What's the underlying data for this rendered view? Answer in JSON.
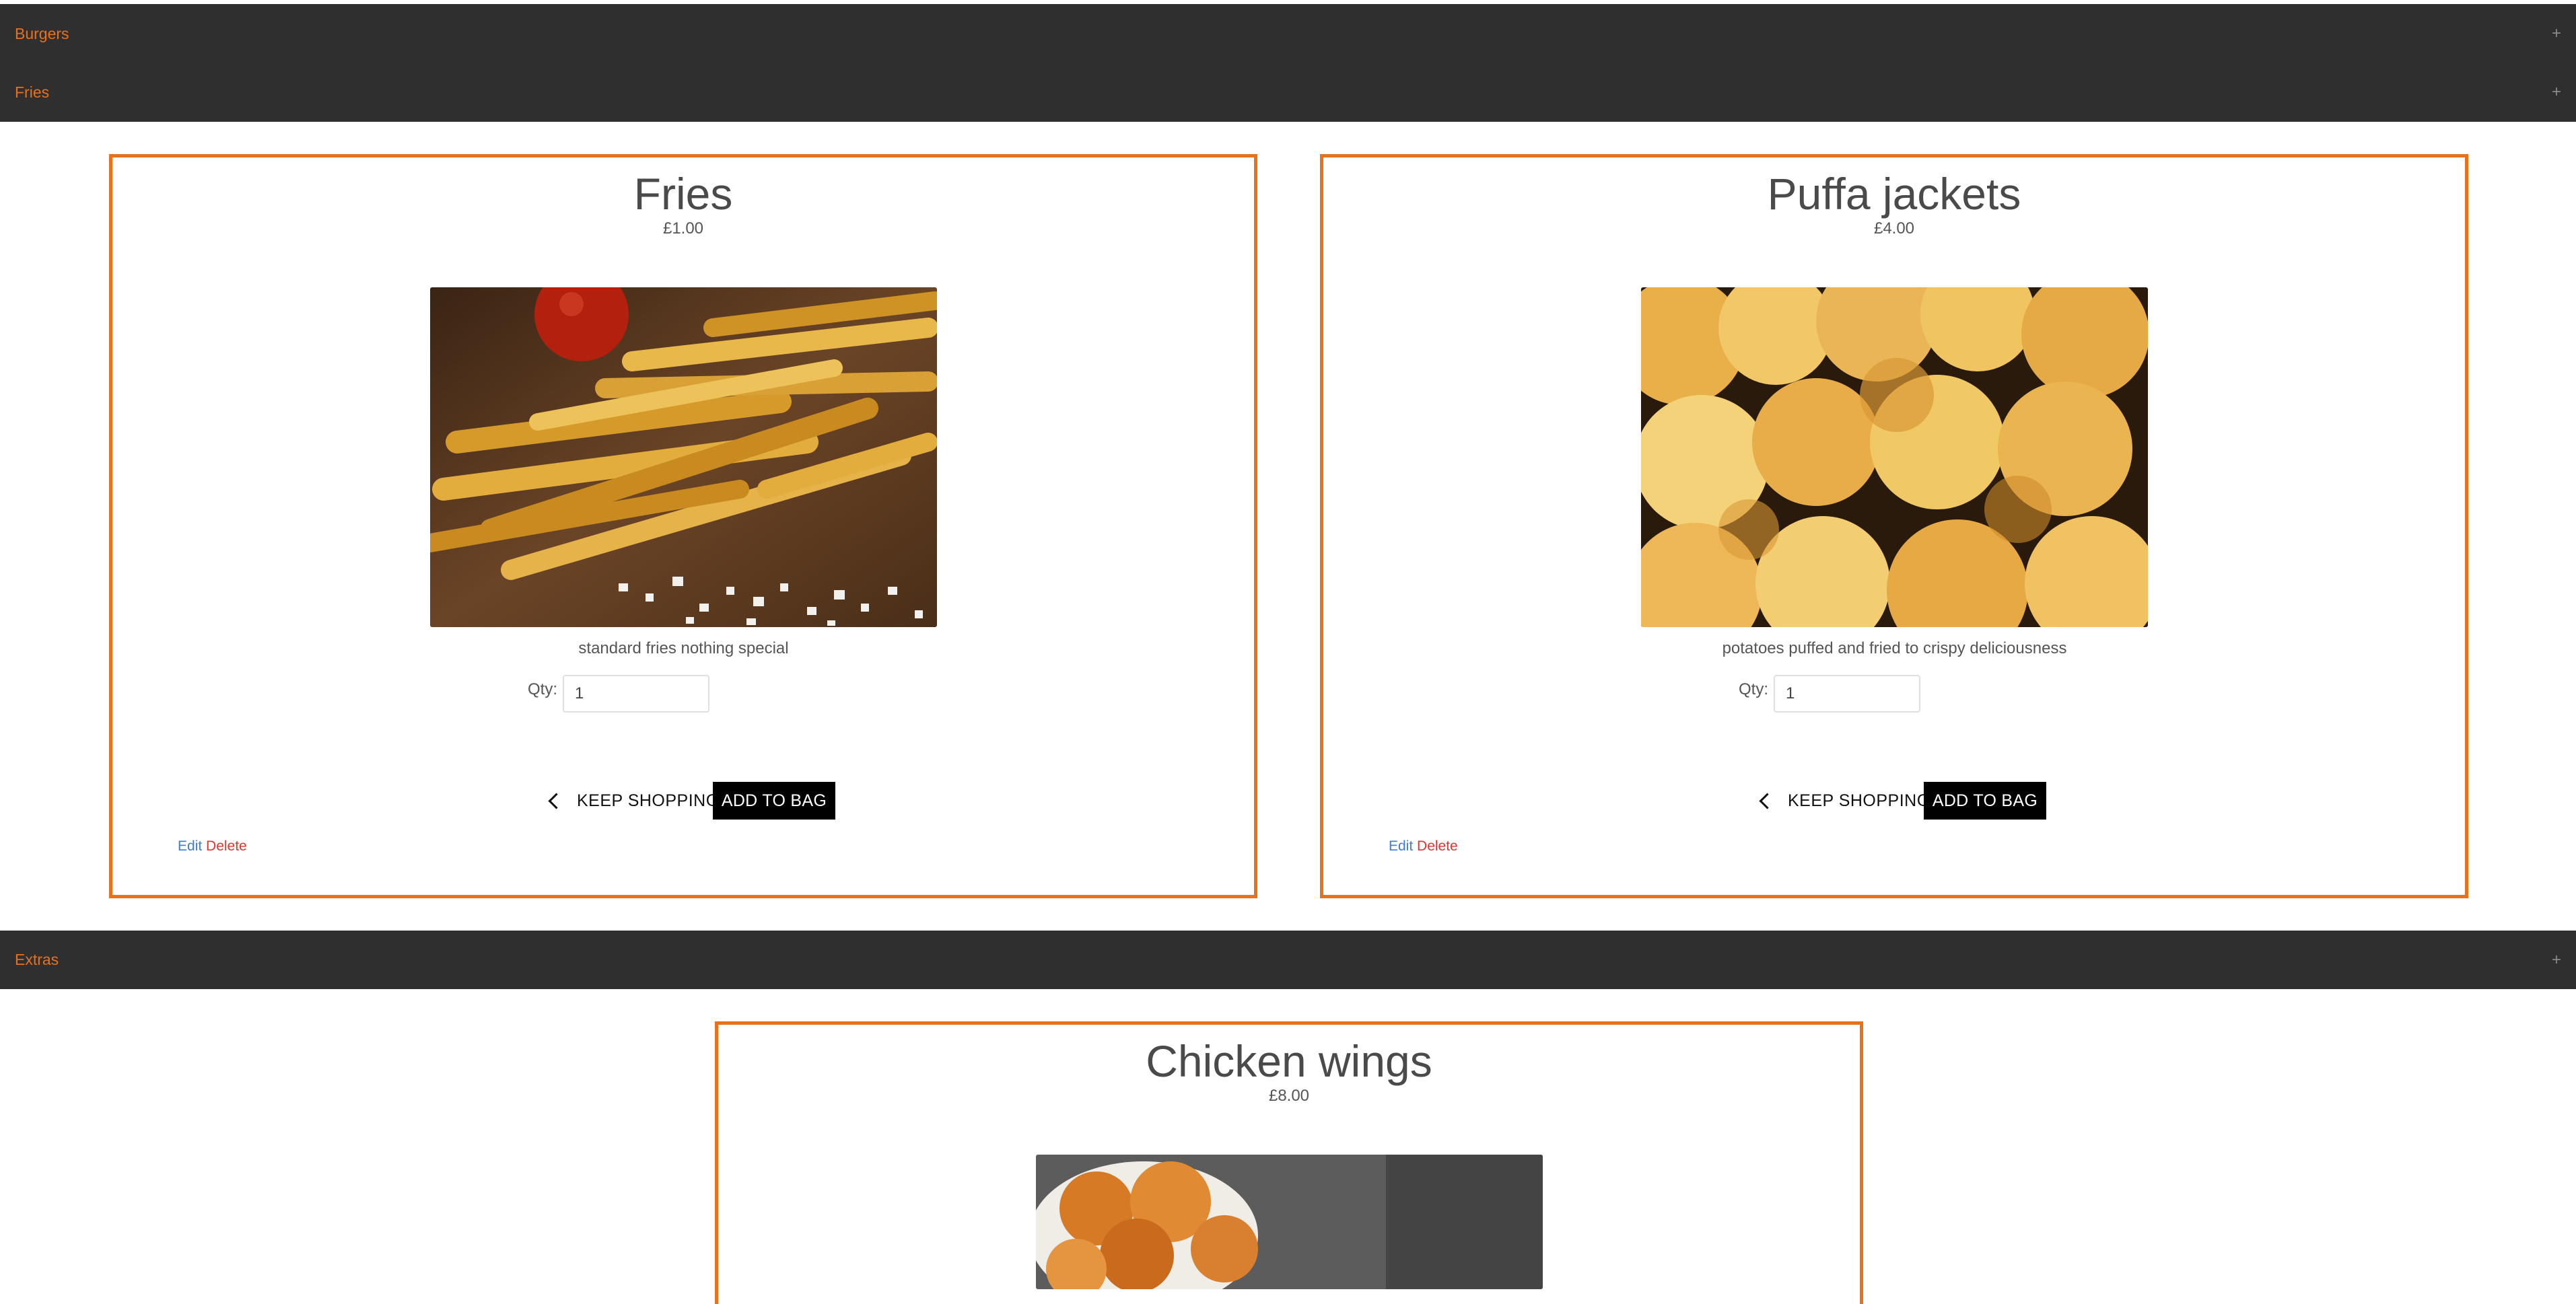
{
  "categories": [
    {
      "name": "Burgers",
      "toggle": "+"
    },
    {
      "name": "Fries",
      "toggle": "+"
    },
    {
      "name": "Extras",
      "toggle": "+"
    }
  ],
  "products": [
    {
      "name": "Fries",
      "price": "£1.00",
      "description": "standard fries nothing special",
      "qty_label": "Qty:",
      "qty": "1",
      "keep_shopping": "KEEP SHOPPING",
      "add_to_bag": "ADD TO BAG",
      "edit": "Edit",
      "delete": "Delete"
    },
    {
      "name": "Puffa jackets",
      "price": "£4.00",
      "description": "potatoes puffed and fried to crispy deliciousness",
      "qty_label": "Qty:",
      "qty": "1",
      "keep_shopping": "KEEP SHOPPING",
      "add_to_bag": "ADD TO BAG",
      "edit": "Edit",
      "delete": "Delete"
    },
    {
      "name": "Chicken wings",
      "price": "£8.00"
    }
  ],
  "colors": {
    "accent": "#e8711c",
    "header_bg": "#2f2f2f",
    "edit": "#3b7ddd",
    "delete": "#e2332f"
  }
}
